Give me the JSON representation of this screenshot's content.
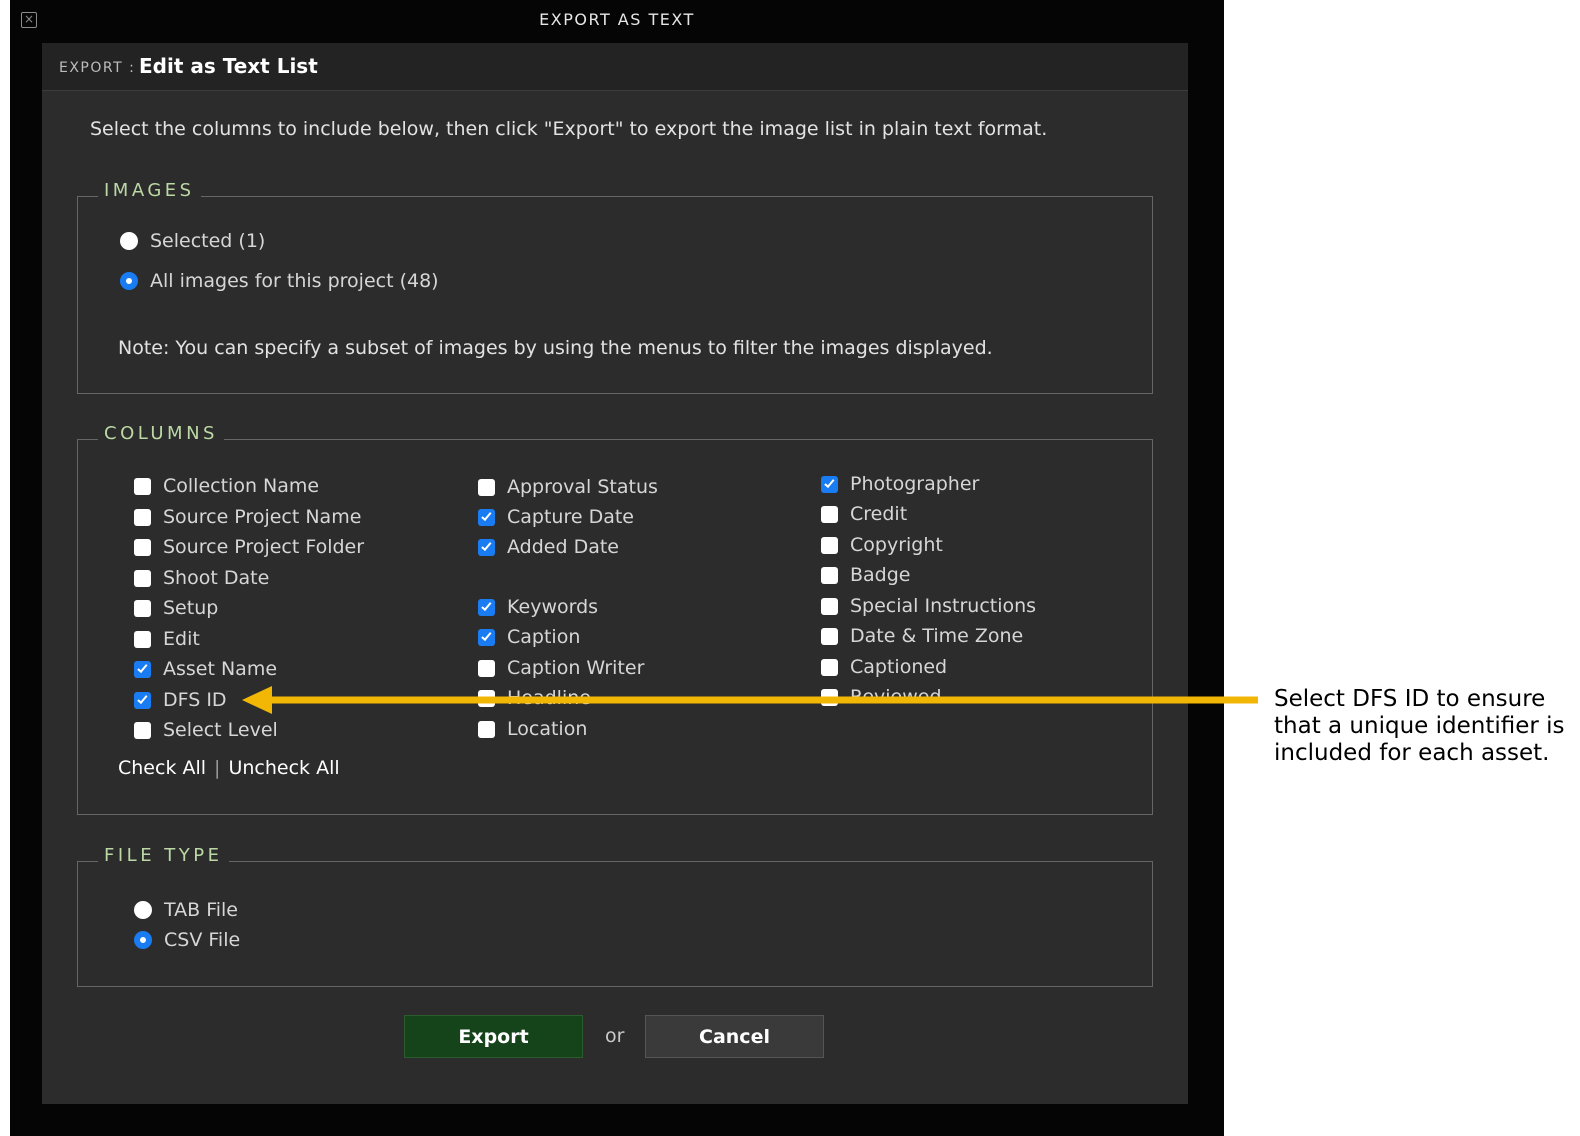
{
  "window": {
    "title": "EXPORT AS TEXT"
  },
  "header": {
    "prefix": "EXPORT :",
    "title": "Edit as Text List"
  },
  "intro": "Select the columns to include below, then click \"Export\" to export the image list in plain text format.",
  "images": {
    "legend": "IMAGES",
    "options": [
      {
        "label": "Selected (1)",
        "checked": false
      },
      {
        "label": "All images for this project (48)",
        "checked": true
      }
    ],
    "note": "Note: You can specify a subset of images by using the menus to filter the images displayed."
  },
  "columns": {
    "legend": "COLUMNS",
    "col1": [
      {
        "label": "Collection Name",
        "checked": false
      },
      {
        "label": "Source Project Name",
        "checked": false
      },
      {
        "label": "Source Project Folder",
        "checked": false
      },
      {
        "label": "Shoot Date",
        "checked": false
      },
      {
        "label": "Setup",
        "checked": false
      },
      {
        "label": "Edit",
        "checked": false
      },
      {
        "label": "Asset Name",
        "checked": true
      },
      {
        "label": "DFS ID",
        "checked": true
      },
      {
        "label": "Select Level",
        "checked": false
      }
    ],
    "col2": [
      {
        "label": "Approval Status",
        "checked": false
      },
      {
        "label": "Capture Date",
        "checked": true
      },
      {
        "label": "Added Date",
        "checked": true
      },
      {
        "label": "Keywords",
        "checked": true
      },
      {
        "label": "Caption",
        "checked": true
      },
      {
        "label": "Caption Writer",
        "checked": false
      },
      {
        "label": "Headline",
        "checked": false
      },
      {
        "label": "Location",
        "checked": false
      }
    ],
    "col3": [
      {
        "label": "Photographer",
        "checked": true
      },
      {
        "label": "Credit",
        "checked": false
      },
      {
        "label": "Copyright",
        "checked": false
      },
      {
        "label": "Badge",
        "checked": false
      },
      {
        "label": "Special Instructions",
        "checked": false
      },
      {
        "label": "Date & Time Zone",
        "checked": false
      },
      {
        "label": "Captioned",
        "checked": false
      },
      {
        "label": "Reviewed",
        "checked": false
      }
    ],
    "check_all": "Check All",
    "separator": "|",
    "uncheck_all": "Uncheck All"
  },
  "file_type": {
    "legend": "FILE TYPE",
    "options": [
      {
        "label": "TAB File",
        "checked": false
      },
      {
        "label": "CSV File",
        "checked": true
      }
    ]
  },
  "actions": {
    "export": "Export",
    "or": "or",
    "cancel": "Cancel"
  },
  "annotation": {
    "text": "Select DFS ID to ensure that a unique identifier is included for each asset.",
    "arrow_color": "#f2b705"
  },
  "colors": {
    "accent": "#1a7cf2",
    "legend": "#bcd9a5",
    "export_button": "#16441a"
  }
}
